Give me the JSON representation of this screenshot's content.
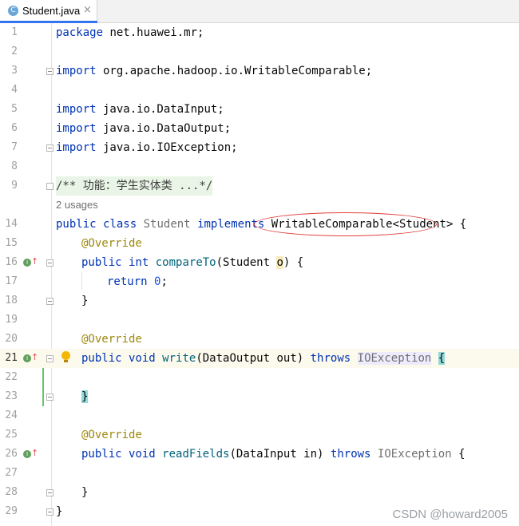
{
  "tab": {
    "icon_letter": "C",
    "file_name": "Student.java",
    "close_glyph": "×"
  },
  "lines": {
    "l1": {
      "num": "1",
      "kw": "package",
      "rest": " net.huawei.mr;"
    },
    "l2": {
      "num": "2"
    },
    "l3": {
      "num": "3",
      "kw": "import",
      "rest": " org.apache.hadoop.io.WritableComparable;"
    },
    "l4": {
      "num": "4"
    },
    "l5": {
      "num": "5",
      "kw": "import",
      "rest": " java.io.DataInput;"
    },
    "l6": {
      "num": "6",
      "kw": "import",
      "rest": " java.io.DataOutput;"
    },
    "l7": {
      "num": "7",
      "kw": "import",
      "rest": " java.io.IOException;"
    },
    "l8": {
      "num": "8"
    },
    "l9": {
      "num": "9",
      "comment": "/** 功能：学生实体类 ...*/"
    },
    "usages": "2 usages",
    "l14": {
      "num": "14",
      "kw1": "public",
      "kw2": "class",
      "cls": "Student",
      "kw3": "implements",
      "iface": "WritableComparable<Student>",
      "brace": " {"
    },
    "l15": {
      "num": "15",
      "ann": "@Override"
    },
    "l16": {
      "num": "16",
      "kw1": "public",
      "kw2": "int",
      "fn": "compareTo",
      "p1": "(Student ",
      "param": "o",
      "p2": ") {"
    },
    "l17": {
      "num": "17",
      "kw": "return",
      "num_val": "0",
      "end": ";"
    },
    "l18": {
      "num": "18",
      "text": "}"
    },
    "l19": {
      "num": "19"
    },
    "l20": {
      "num": "20",
      "ann": "@Override"
    },
    "l21": {
      "num": "21",
      "kw1": "public",
      "kw2": "void",
      "fn": "write",
      "args": "(DataOutput out) ",
      "kw3": "throws",
      "exc": "IOException",
      "brace": "{"
    },
    "l22": {
      "num": "22"
    },
    "l23": {
      "num": "23",
      "brace": "}"
    },
    "l24": {
      "num": "24"
    },
    "l25": {
      "num": "25",
      "ann": "@Override"
    },
    "l26": {
      "num": "26",
      "kw1": "public",
      "kw2": "void",
      "fn": "readFields",
      "args": "(DataInput in) ",
      "kw3": "throws",
      "exc": "IOException",
      "brace": " {"
    },
    "l27": {
      "num": "27"
    },
    "l28": {
      "num": "28",
      "text": "}"
    },
    "l29": {
      "num": "29",
      "text": "}"
    }
  },
  "gutter_icons": {
    "impl_letter": "I",
    "arrow_glyph": "↑"
  },
  "watermark": "CSDN @howard2005",
  "colors": {
    "keyword": "#0033b3",
    "annotation": "#9e880d",
    "method": "#00627a",
    "number": "#1750eb",
    "highlight_line": "#fcfaed",
    "annotation_ring": "#e0403a"
  }
}
